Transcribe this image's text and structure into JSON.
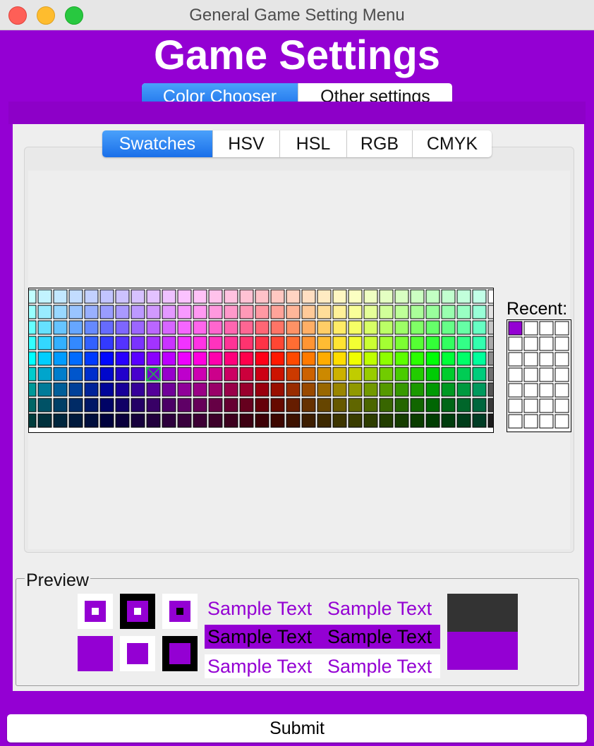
{
  "window": {
    "title": "General Game Setting Menu"
  },
  "heading": "Game Settings",
  "main_tabs": [
    {
      "label": "Color Chooser",
      "selected": true
    },
    {
      "label": "Other settings",
      "selected": false
    }
  ],
  "chooser_tabs": [
    {
      "label": "Swatches",
      "selected": true
    },
    {
      "label": "HSV",
      "selected": false
    },
    {
      "label": "HSL",
      "selected": false
    },
    {
      "label": "RGB",
      "selected": false
    },
    {
      "label": "CMYK",
      "selected": false
    }
  ],
  "swatches": {
    "recent_label": "Recent:",
    "recent_colors": [
      "#9400d3"
    ]
  },
  "preview": {
    "title": "Preview",
    "sample_text": "Sample Text",
    "selected_color": "#9400d3",
    "dark_color": "#333333"
  },
  "submit_label": "Submit",
  "colors": {
    "background": "#9400d3",
    "tab_selected": "#2f86f5"
  }
}
